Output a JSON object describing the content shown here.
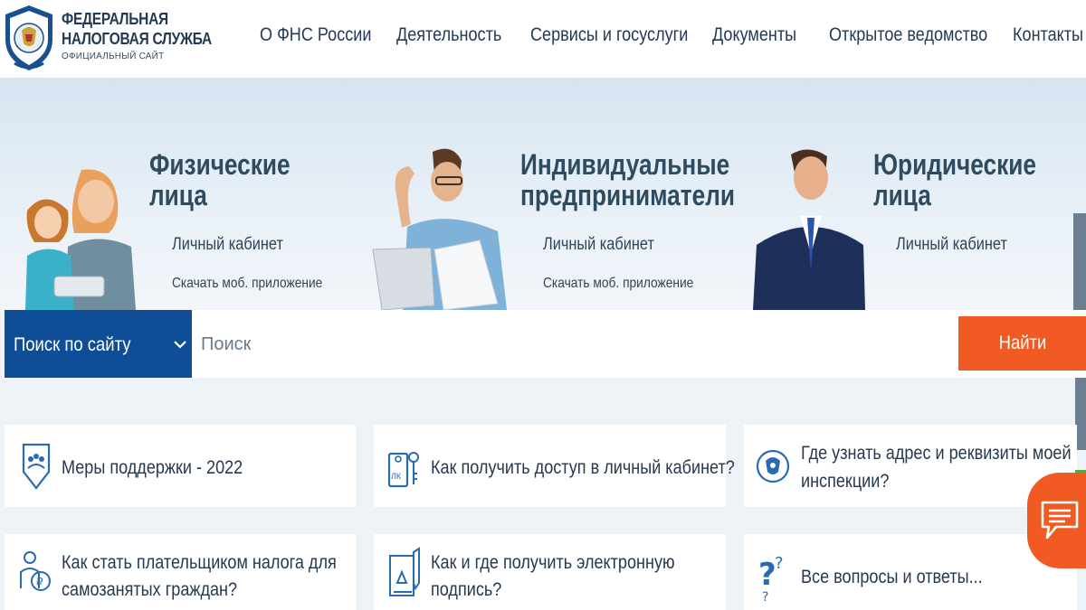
{
  "header": {
    "logo_line1": "ФЕДЕРАЛЬНАЯ",
    "logo_line2": "НАЛОГОВАЯ СЛУЖБА",
    "logo_line3": "ОФИЦИАЛЬНЫЙ САЙТ",
    "emblem_icon": "fns-emblem-icon"
  },
  "nav": {
    "items": [
      {
        "label": "О ФНС России"
      },
      {
        "label": "Деятельность"
      },
      {
        "label": "Сервисы и госуслуги"
      },
      {
        "label": "Документы"
      },
      {
        "label": "Открытое ведомство"
      },
      {
        "label": "Контакты"
      }
    ]
  },
  "hero": {
    "sections": [
      {
        "title_l1": "Физические",
        "title_l2": "лица",
        "link": "Личный кабинет",
        "sublink": "Скачать моб. приложение"
      },
      {
        "title_l1": "Индивидуальные",
        "title_l2": "предприниматели",
        "link": "Личный кабинет",
        "sublink": "Скачать моб. приложение"
      },
      {
        "title_l1": "Юридические",
        "title_l2": "лица",
        "link": "Личный кабинет"
      }
    ]
  },
  "search": {
    "scope_label": "Поиск по сайту",
    "placeholder": "Поиск",
    "button_label": "Найти"
  },
  "cards": [
    {
      "l1": "Меры поддержки - 2022",
      "l2": "",
      "icon": "support-shield-icon"
    },
    {
      "l1": "Как получить доступ в личный кабинет?",
      "l2": "",
      "icon": "key-tag-icon"
    },
    {
      "l1": "Где узнать адрес и реквизиты моей",
      "l2": "инспекции?",
      "icon": "emblem-circle-icon"
    },
    {
      "l1": "Как стать плательщиком налога для",
      "l2": "самозанятых граждан?",
      "icon": "self-employed-icon"
    },
    {
      "l1": "Как и где получить электронную",
      "l2": "подпись?",
      "icon": "e-signature-icon"
    },
    {
      "l1": "Все вопросы и ответы...",
      "l2": "",
      "icon": "question-marks-icon"
    }
  ],
  "colors": {
    "brand_blue": "#0f4d96",
    "accent_orange": "#f15a22",
    "text_dark": "#26394f"
  }
}
